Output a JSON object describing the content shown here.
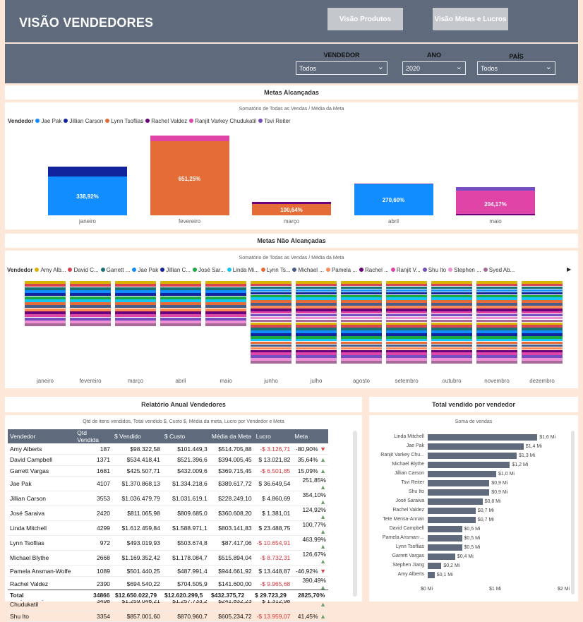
{
  "header": {
    "title": "VISÃO VENDEDORES",
    "btn_produtos": "Visão Produtos",
    "btn_metas": "Visão Metas e Lucros"
  },
  "filters": {
    "vendedor": {
      "label": "VENDEDOR",
      "value": "Todos"
    },
    "ano": {
      "label": "ANO",
      "value": "2020"
    },
    "pais": {
      "label": "PAÍS",
      "value": "Todos"
    }
  },
  "metas_alcancadas": {
    "title": "Metas Alcançadas",
    "subtitle": "Somatório de Todas as Vendas / Média da Meta",
    "legend_title": "Vendedor",
    "legend": [
      {
        "name": "Jae Pak",
        "color": "#118dff"
      },
      {
        "name": "Jillian Carson",
        "color": "#12239e"
      },
      {
        "name": "Lynn Tsoflias",
        "color": "#e66c37"
      },
      {
        "name": "Rachel Valdez",
        "color": "#6b007b"
      },
      {
        "name": "Ranjit Varkey Chudukatil",
        "color": "#e044a7"
      },
      {
        "name": "Tsvi Reiter",
        "color": "#744ec2"
      }
    ],
    "chart_data": {
      "type": "bar",
      "categories": [
        "janeiro",
        "fevereiro",
        "março",
        "abril",
        "maio"
      ],
      "labels": [
        "338,92%",
        "651,25%",
        "100,64%",
        "270,60%",
        "204,17%"
      ],
      "series": [
        {
          "name": "Jae Pak",
          "values": [
            338.92,
            0,
            0,
            270.6,
            0
          ]
        },
        {
          "name": "Jillian Carson",
          "values": [
            90,
            0,
            0,
            0,
            0
          ]
        },
        {
          "name": "Lynn Tsoflias",
          "values": [
            0,
            651.25,
            100.64,
            0,
            0
          ]
        },
        {
          "name": "Rachel Valdez",
          "values": [
            0,
            0,
            15,
            0,
            15
          ]
        },
        {
          "name": "Ranjit Varkey Chudukatil",
          "values": [
            0,
            50,
            0,
            0,
            204.17
          ]
        },
        {
          "name": "Tsvi Reiter",
          "values": [
            0,
            0,
            0,
            8,
            30
          ]
        }
      ]
    }
  },
  "metas_nao_alcancadas": {
    "title": "Metas Não Alcançadas",
    "subtitle": "Somatório de Todas as Vendas / Média da Meta",
    "legend_title": "Vendedor",
    "legend": [
      {
        "name": "Amy Alb...",
        "color": "#d9b300"
      },
      {
        "name": "David C...",
        "color": "#d64550"
      },
      {
        "name": "Garrett ...",
        "color": "#197278"
      },
      {
        "name": "Jae Pak",
        "color": "#118dff"
      },
      {
        "name": "Jillian C...",
        "color": "#12239e"
      },
      {
        "name": "José Sar...",
        "color": "#1aab40"
      },
      {
        "name": "Linda Mi...",
        "color": "#15c6f4"
      },
      {
        "name": "Lynn Ts...",
        "color": "#e66c37"
      },
      {
        "name": "Michael ...",
        "color": "#4a5d8a"
      },
      {
        "name": "Pamela ...",
        "color": "#fe8a55"
      },
      {
        "name": "Rachel ...",
        "color": "#6b007b"
      },
      {
        "name": "Ranjit V...",
        "color": "#e044a7"
      },
      {
        "name": "Shu Ito",
        "color": "#744ec2"
      },
      {
        "name": "Stephen ...",
        "color": "#f08fd4"
      },
      {
        "name": "Syed Ab...",
        "color": "#a66999"
      }
    ],
    "months": [
      "janeiro",
      "fevereiro",
      "março",
      "abril",
      "maio",
      "junho",
      "julho",
      "agosto",
      "setembro",
      "outubro",
      "novembro",
      "dezembro"
    ]
  },
  "relatorio": {
    "title": "Relatório Anual Vendedores",
    "subtitle": "Qtd de itens vendidos, Total vendido $, Custo $, Média da meta, Lucro por Vendedor e Meta",
    "columns": [
      "Vendedor",
      "Qtd Vendida",
      "$ Vendido",
      "$ Custo",
      "Média da Meta",
      "Lucro",
      "Meta"
    ],
    "rows": [
      [
        "Amy Alberts",
        "187",
        "$98.322,58",
        "$101.449,3",
        "$514.705,88",
        "-$ 3.126,71",
        "-80,90%",
        "dn"
      ],
      [
        "David Campbell",
        "1371",
        "$534.418,41",
        "$521.396,6",
        "$394.005,45",
        "$ 13.021,82",
        "35,64%",
        "up"
      ],
      [
        "Garrett Vargas",
        "1681",
        "$425.507,71",
        "$432.009,6",
        "$369.715,45",
        "-$ 6.501,85",
        "15,09%",
        "up"
      ],
      [
        "Jae Pak",
        "4107",
        "$1.370.868,13",
        "$1.334.218,6",
        "$389.617,72",
        "$ 36.649,54",
        "251,85%",
        "up"
      ],
      [
        "Jillian Carson",
        "3553",
        "$1.036.479,79",
        "$1.031.619,1",
        "$228.249,10",
        "$ 4.860,69",
        "354,10%",
        "up"
      ],
      [
        "José Saraiva",
        "2420",
        "$811.065,98",
        "$809.685,0",
        "$360.608,20",
        "$ 1.381,01",
        "124,92%",
        "up"
      ],
      [
        "Linda Mitchell",
        "4299",
        "$1.612.459,84",
        "$1.588.971,1",
        "$803.141,83",
        "$ 23.488,75",
        "100,77%",
        "up"
      ],
      [
        "Lynn Tsoflias",
        "972",
        "$493.019,93",
        "$503.674,8",
        "$87.417,06",
        "-$ 10.654,91",
        "463,99%",
        "up"
      ],
      [
        "Michael Blythe",
        "2668",
        "$1.169.352,42",
        "$1.178.084,7",
        "$515.894,04",
        "-$ 8.732,31",
        "126,67%",
        "up"
      ],
      [
        "Pamela Ansman-Wolfe",
        "1089",
        "$501.440,25",
        "$487.991,4",
        "$944.661,92",
        "$ 13.448,87",
        "-46,92%",
        "dn"
      ],
      [
        "Rachel Valdez",
        "2390",
        "$694.540,22",
        "$704.505,9",
        "$141.600,00",
        "-$ 9.965,68",
        "390,49%",
        "up"
      ],
      [
        "Ranjit Varkey Chudukatil",
        "3498",
        "$1.259.046,21",
        "$1.257.733,2",
        "$241.832,23",
        "$ 1.312,98",
        "420,63%",
        "up"
      ],
      [
        "Shu Ito",
        "3354",
        "$857.001,60",
        "$870.960,7",
        "$605.234,72",
        "-$ 13.959,07",
        "41,45%",
        "up"
      ]
    ],
    "total": {
      "label": "Total",
      "qtd": "34866",
      "vendido": "$12.650.022,79",
      "custo": "$12.620.299,5",
      "media": "$432.375,72",
      "lucro": "$ 29.723,29",
      "meta": "2825,70%"
    }
  },
  "total_vendido": {
    "title": "Total vendido por vendedor",
    "subtitle": "Soma de vendas",
    "chart_data": {
      "type": "bar",
      "orientation": "horizontal",
      "categories": [
        "Linda Mitchell",
        "Jae Pak",
        "Ranjit Varkey Chu...",
        "Michael Blythe",
        "Jillian Carson",
        "Tsvi Reiter",
        "Shu Ito",
        "José Saraiva",
        "Rachel Valdez",
        "Tete Mensa-Annan",
        "David Campbell",
        "Pamela Ansman-...",
        "Lynn Tsoflias",
        "Garrett Vargas",
        "Stephen Jiang",
        "Amy Alberts"
      ],
      "values": [
        1.6,
        1.4,
        1.3,
        1.2,
        1.0,
        0.9,
        0.9,
        0.8,
        0.7,
        0.7,
        0.5,
        0.5,
        0.5,
        0.4,
        0.2,
        0.1
      ],
      "value_labels": [
        "$1,6 Mi",
        "$1,4 Mi",
        "$1,3 Mi",
        "$1,2 Mi",
        "$1,0 Mi",
        "$0,9 Mi",
        "$0,9 Mi",
        "$0,8 Mi",
        "$0,7 Mi",
        "$0,7 Mi",
        "$0,5 Mi",
        "$0,5 Mi",
        "$0,5 Mi",
        "$0,4 Mi",
        "$0,2 Mi",
        "$0,1 Mi"
      ],
      "xticks": [
        "$0 Mi",
        "$1 Mi",
        "$2 Mi"
      ],
      "xlim": [
        0,
        2
      ]
    }
  }
}
